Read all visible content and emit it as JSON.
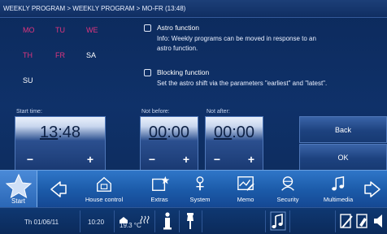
{
  "breadcrumb": "WEEKLY PROGRAM > WEEKLY PROGRAM > MO-FR (13:48)",
  "days": {
    "mo": "MO",
    "tu": "TU",
    "we": "WE",
    "th": "TH",
    "fr": "FR",
    "sa": "SA",
    "su": "SU"
  },
  "colors": {
    "selected_day": "#e0357f",
    "unselected_day": "#ffffff"
  },
  "options": {
    "astro": {
      "title": "Astro function",
      "info_line1": "Info: Weekly programs can be moved in response to an",
      "info_line2": "astro function."
    },
    "blocking": {
      "title": "Blocking function",
      "info": "Set the astro shift via the parameters \"earliest\" and \"latest\"."
    }
  },
  "start_time": {
    "label": "Start time:",
    "hours": "13",
    "minutes": ":48"
  },
  "not_before": {
    "label": "Not before:",
    "hours": "00",
    "minutes": ":00"
  },
  "not_after": {
    "label": "Not after:",
    "hours": "00",
    "minutes": ":00"
  },
  "spinner": {
    "minus": "−",
    "plus": "+"
  },
  "buttons": {
    "back": "Back",
    "ok": "OK"
  },
  "nav": {
    "start": "Start",
    "house_control": "House control",
    "extras": "Extras",
    "system": "System",
    "memo": "Memo",
    "security": "Security",
    "multimedia": "Multimedia"
  },
  "status": {
    "date": "Th 01/06/11",
    "time": "10:20",
    "temperature": "19.3 °C"
  }
}
